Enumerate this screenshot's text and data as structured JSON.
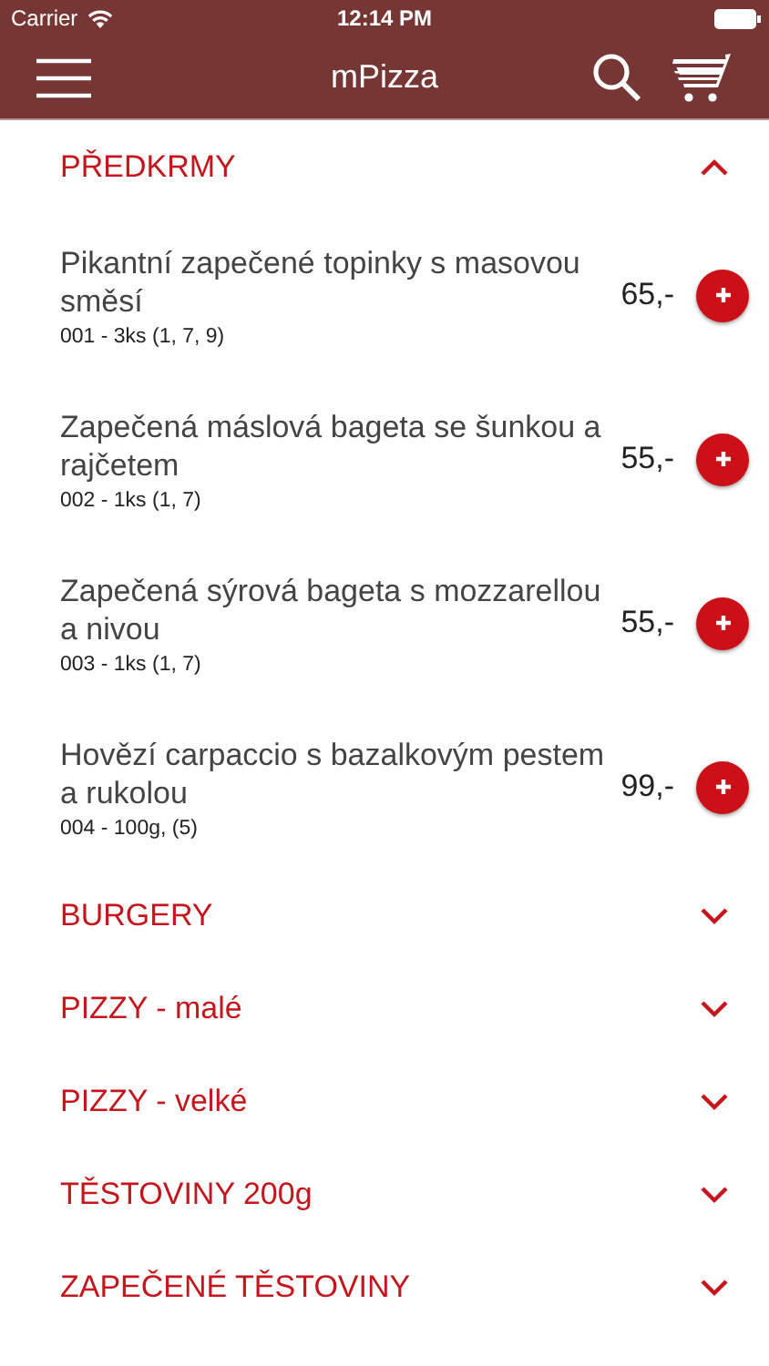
{
  "status_bar": {
    "carrier": "Carrier",
    "time": "12:14 PM"
  },
  "nav_bar": {
    "title": "mPizza"
  },
  "categories": [
    {
      "title": "PŘEDKRMY",
      "expanded": true,
      "items": [
        {
          "name": "Pikantní zapečené topinky s masovou směsí",
          "details": "001 - 3ks (1, 7, 9)",
          "price": "65,-"
        },
        {
          "name": "Zapečená máslová bageta se šunkou a rajčetem",
          "details": "002 - 1ks (1, 7)",
          "price": "55,-"
        },
        {
          "name": "Zapečená sýrová bageta s mozzarellou a nivou",
          "details": "003 - 1ks (1, 7)",
          "price": "55,-"
        },
        {
          "name": "Hovězí carpaccio s bazalkovým pestem a rukolou",
          "details": "004 - 100g, (5)",
          "price": "99,-"
        }
      ]
    },
    {
      "title": "BURGERY",
      "expanded": false
    },
    {
      "title": "PIZZY - malé",
      "expanded": false
    },
    {
      "title": "PIZZY - velké",
      "expanded": false
    },
    {
      "title": "TĚSTOVINY 200g",
      "expanded": false
    },
    {
      "title": "ZAPEČENÉ TĚSTOVINY",
      "expanded": false
    }
  ]
}
